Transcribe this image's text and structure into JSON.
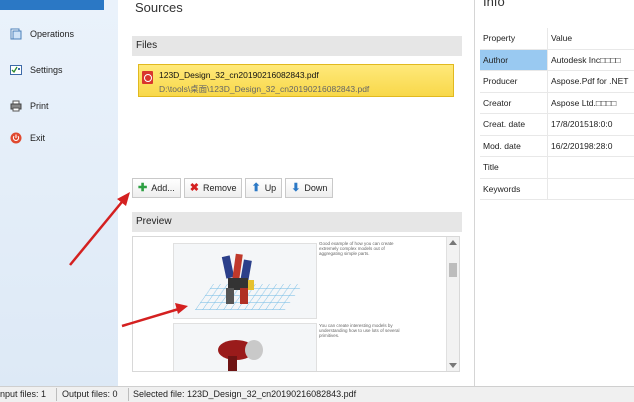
{
  "sidebar": {
    "items": [
      {
        "label": "Operations",
        "icon": "operations-icon"
      },
      {
        "label": "Settings",
        "icon": "settings-icon"
      },
      {
        "label": "Print",
        "icon": "printer-icon"
      },
      {
        "label": "Exit",
        "icon": "power-icon"
      }
    ]
  },
  "sources": {
    "title": "Sources",
    "files_header": "Files",
    "file": {
      "name": "123D_Design_32_cn20190216082843.pdf",
      "path": "D:\\tools\\桌面\\123D_Design_32_cn20190216082843.pdf"
    },
    "toolbar": {
      "add": "Add...",
      "remove": "Remove",
      "up": "Up",
      "down": "Down"
    },
    "preview_header": "Preview",
    "preview_text_1": "Good example of how you can create extremely complex models out of aggregating simple parts.",
    "preview_text_2": "You can create interesting models by understanding how to use lots of several primitives."
  },
  "info": {
    "title": "Info",
    "col_property": "Property",
    "col_value": "Value",
    "rows": [
      {
        "k": "Author",
        "v": "Autodesk Inc□□□□"
      },
      {
        "k": "Producer",
        "v": "Aspose.Pdf for .NET"
      },
      {
        "k": "Creator",
        "v": "Aspose Ltd.□□□□"
      },
      {
        "k": "Creat. date",
        "v": "17/8/201518:0:0"
      },
      {
        "k": "Mod. date",
        "v": "16/2/20198:28:0"
      },
      {
        "k": "Title",
        "v": ""
      },
      {
        "k": "Keywords",
        "v": ""
      }
    ]
  },
  "status": {
    "input": "nput files: 1",
    "output": "Output files: 0",
    "selected": "Selected file: 123D_Design_32_cn20190216082843.pdf"
  },
  "colors": {
    "accent": "#2b78c5",
    "file_highlight": "#f8d84a",
    "selected_row": "#99c9f1",
    "annotation_arrow": "#d42020"
  }
}
